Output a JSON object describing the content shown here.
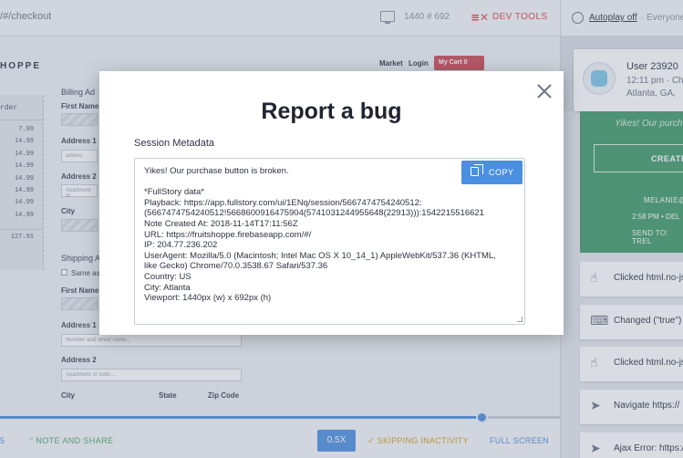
{
  "topbar": {
    "url": "/#/checkout",
    "viewport": "1440 # 692",
    "devtools_icon": "≡✕",
    "devtools_label": "DEV TOOLS"
  },
  "site": {
    "brand": "HOPPE",
    "nav_market": "Market",
    "nav_login": "Login",
    "cart_label": "My Cart 0",
    "order_heading": "rder",
    "order_prices": [
      "7.99",
      "14.99",
      "14.99",
      "14.99",
      "14.99",
      "14.99",
      "14.99",
      "14.99"
    ],
    "order_total": "127.91",
    "billing_heading": "Billing Ad",
    "shipping_heading": "Shipping A",
    "same_as": "Same as",
    "labels": {
      "first_name": "First Name",
      "address1": "Address 1",
      "address2": "Address 2",
      "city": "City",
      "state": "State",
      "zip": "Zip Code"
    },
    "placeholders": {
      "adress": "adress",
      "apartment_billing": "Apartment or",
      "street": "Number and street name...",
      "apartment": "Apartment or suite..."
    }
  },
  "bottombar": {
    "left_fragment": "5",
    "note_icon": "“",
    "note_label": "NOTE AND SHARE",
    "speed": "0.5X",
    "skip_icon": "✓",
    "skip_label": "SKIPPING INACTIVITY",
    "fullscreen": "FULL SCREEN",
    "progress_fraction": 0.86
  },
  "right": {
    "autoplay": "Autoplay off",
    "everyone": "· Everyone",
    "user_name": "User 23920",
    "user_time": "12:11 pm · Chro",
    "user_location": "Atlanta, GA,",
    "green": {
      "yikes": "Yikes! Our purch",
      "create": "CREATE",
      "email": "MELANIE@",
      "time": "2:58 PM • DEL",
      "send_to": "SEND TO: TREL"
    },
    "events": [
      {
        "icon": "pointer-icon",
        "glyph": "☝",
        "text": "Clicked html.no-js"
      },
      {
        "icon": "keyboard-icon",
        "glyph": "⌨",
        "text": "Changed (\"true\")"
      },
      {
        "icon": "pointer-icon",
        "glyph": "☝",
        "text": "Clicked html.no-js"
      },
      {
        "icon": "navigate-icon",
        "glyph": "➤",
        "text": "Navigate https://"
      },
      {
        "icon": "error-icon",
        "glyph": "➤",
        "text": "Ajax Error: https:/"
      }
    ]
  },
  "modal": {
    "title": "Report a bug",
    "section": "Session Metadata",
    "copy_label": "COPY",
    "lines": [
      "Yikes! Our purchase button is broken.",
      "",
      "*FullStory data*",
      "Playback: https://app.fullstory.com/ui/1ENq/session/5667474754240512:",
      "(5667474754240512!5668600916475904(5741031244955648(22913))):1542215516621",
      "Note Created At: 2018-11-14T17:11:56Z",
      "URL: https://fruitshoppe.firebaseapp.com/#/",
      "IP: 204.77.236.202",
      "UserAgent: Mozilla/5.0 (Macintosh; Intel Mac OS X 10_14_1) AppleWebKit/537.36 (KHTML,",
      "like Gecko) Chrome/70.0.3538.67 Safari/537.36",
      "Country: US",
      "City: Atlanta",
      "Viewport: 1440px (w) x 692px (h)"
    ]
  }
}
